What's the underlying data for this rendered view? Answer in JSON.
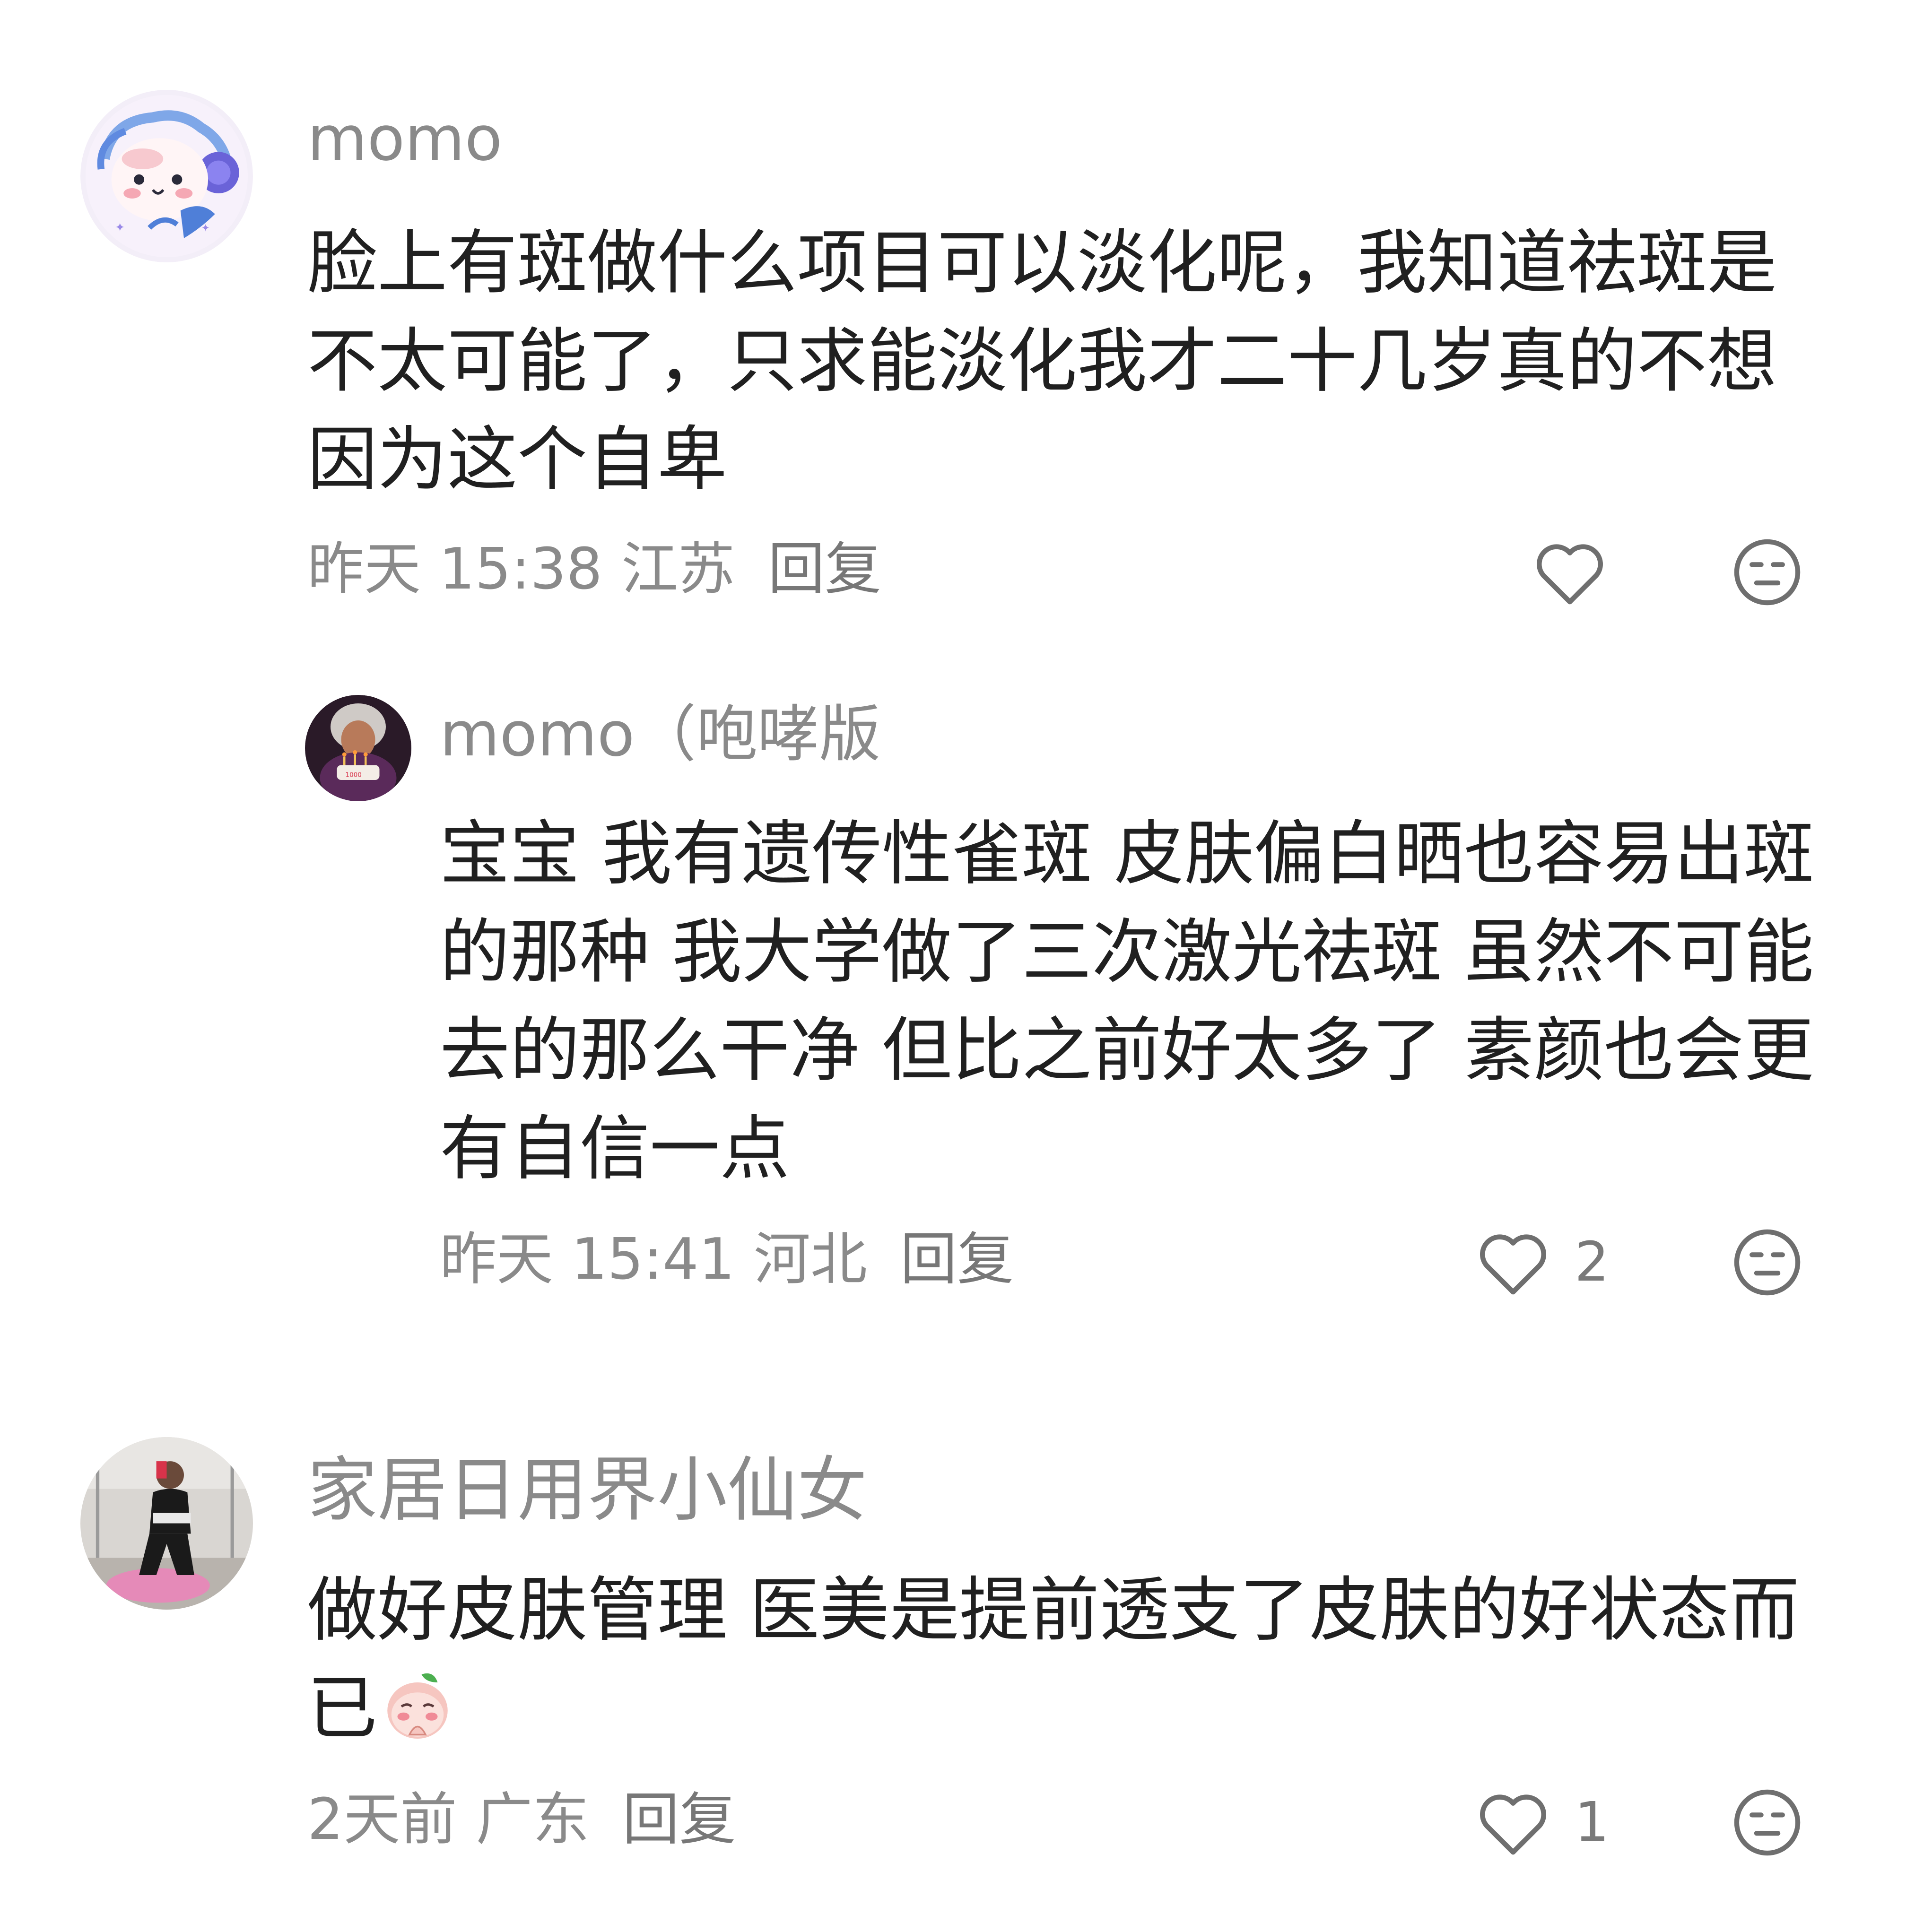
{
  "comments": [
    {
      "username": "momo",
      "content": "脸上有斑做什么项目可以淡化呢，我知道祛斑是不太可能了，只求能淡化我才二十几岁真的不想因为这个自卑",
      "time": "昨天 15:38",
      "region": "江苏",
      "reply_label": "回复",
      "like_count": "",
      "avatar_icon": "cartoon-avatar-with-headphones",
      "replies": [
        {
          "username": "momo（咆哮版",
          "content": "宝宝 我有遗传性雀斑 皮肤偏白晒也容易出斑的那种 我大学做了三次激光祛斑 虽然不可能去的那么干净 但比之前好太多了 素颜也会更有自信一点",
          "time": "昨天 15:41",
          "region": "河北",
          "reply_label": "回复",
          "like_count": "2",
          "avatar_icon": "grandma-birthday-cake-avatar"
        }
      ]
    },
    {
      "username": "家居日用界小仙女",
      "content": "做好皮肤管理 医美是提前透支了皮肤的好状态而已",
      "content_emoji": "peach-praying-emoji",
      "time": "2天前",
      "region": "广东",
      "reply_label": "回复",
      "like_count": "1",
      "avatar_icon": "gym-selfie-photo-avatar"
    }
  ],
  "icons": {
    "like": "heart-outline-icon",
    "dislike": "neutral-face-icon"
  },
  "colors": {
    "text_primary": "#202020",
    "text_secondary": "#8a8a8a",
    "icon_gray": "#6f6f6f"
  }
}
